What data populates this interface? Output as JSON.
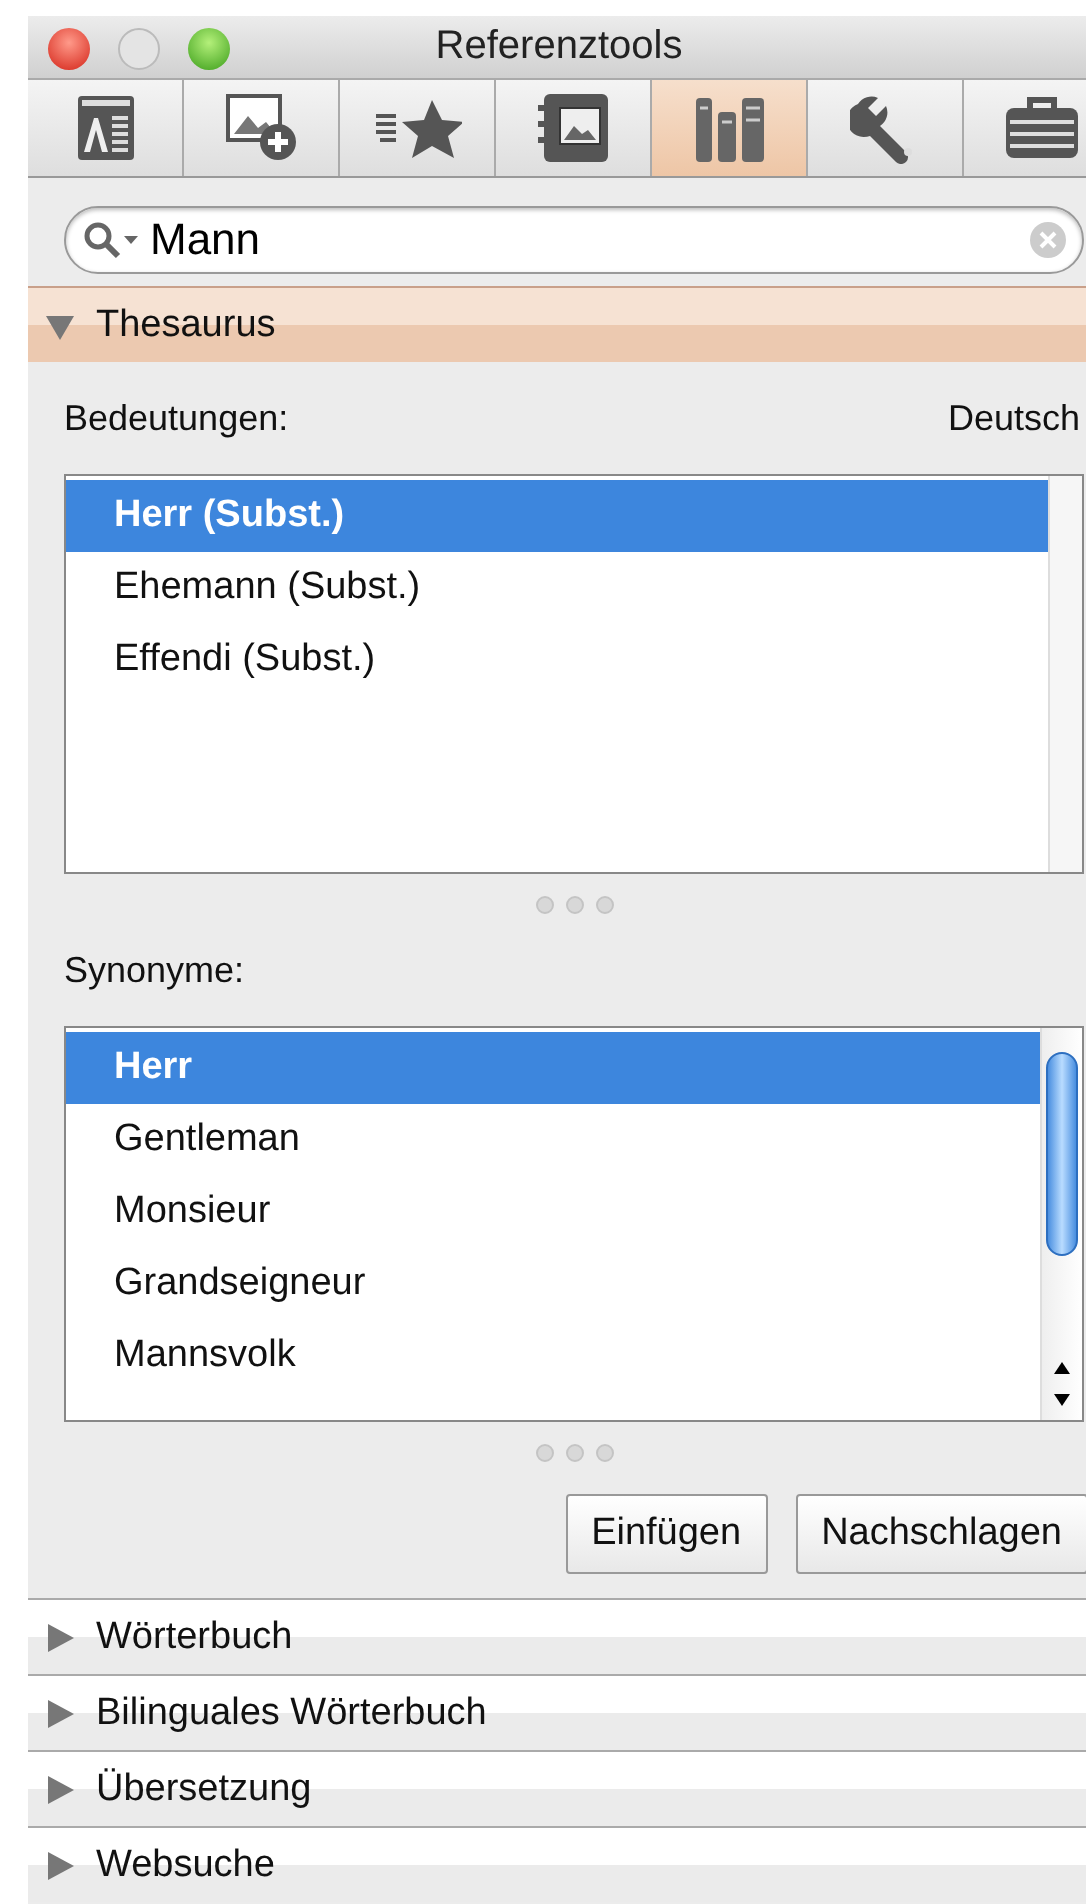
{
  "window": {
    "title": "Referenztools"
  },
  "toolbar": [
    {
      "selected": false
    },
    {
      "selected": false
    },
    {
      "selected": false
    },
    {
      "selected": false
    },
    {
      "selected": true
    },
    {
      "selected": false
    },
    {
      "selected": false
    }
  ],
  "search": {
    "value": "Mann"
  },
  "sections": [
    {
      "title": "Thesaurus",
      "expanded": true
    },
    {
      "title": "Wörterbuch",
      "expanded": false
    },
    {
      "title": "Bilinguales Wörterbuch",
      "expanded": false
    },
    {
      "title": "Übersetzung",
      "expanded": false
    },
    {
      "title": "Websuche",
      "expanded": false
    }
  ],
  "thesaurus": {
    "meanings_label": "Bedeutungen:",
    "language": "Deutsch",
    "meanings": [
      {
        "text": "Herr (Subst.)",
        "selected": true
      },
      {
        "text": "Ehemann (Subst.)",
        "selected": false
      },
      {
        "text": "Effendi (Subst.)",
        "selected": false
      }
    ],
    "synonyms_label": "Synonyme:",
    "synonyms": [
      {
        "text": "Herr",
        "selected": true
      },
      {
        "text": "Gentleman",
        "selected": false
      },
      {
        "text": "Monsieur",
        "selected": false
      },
      {
        "text": "Grandseigneur",
        "selected": false
      },
      {
        "text": "Mannsvolk",
        "selected": false
      }
    ],
    "buttons": [
      "Einfügen",
      "Nachschlagen"
    ]
  }
}
